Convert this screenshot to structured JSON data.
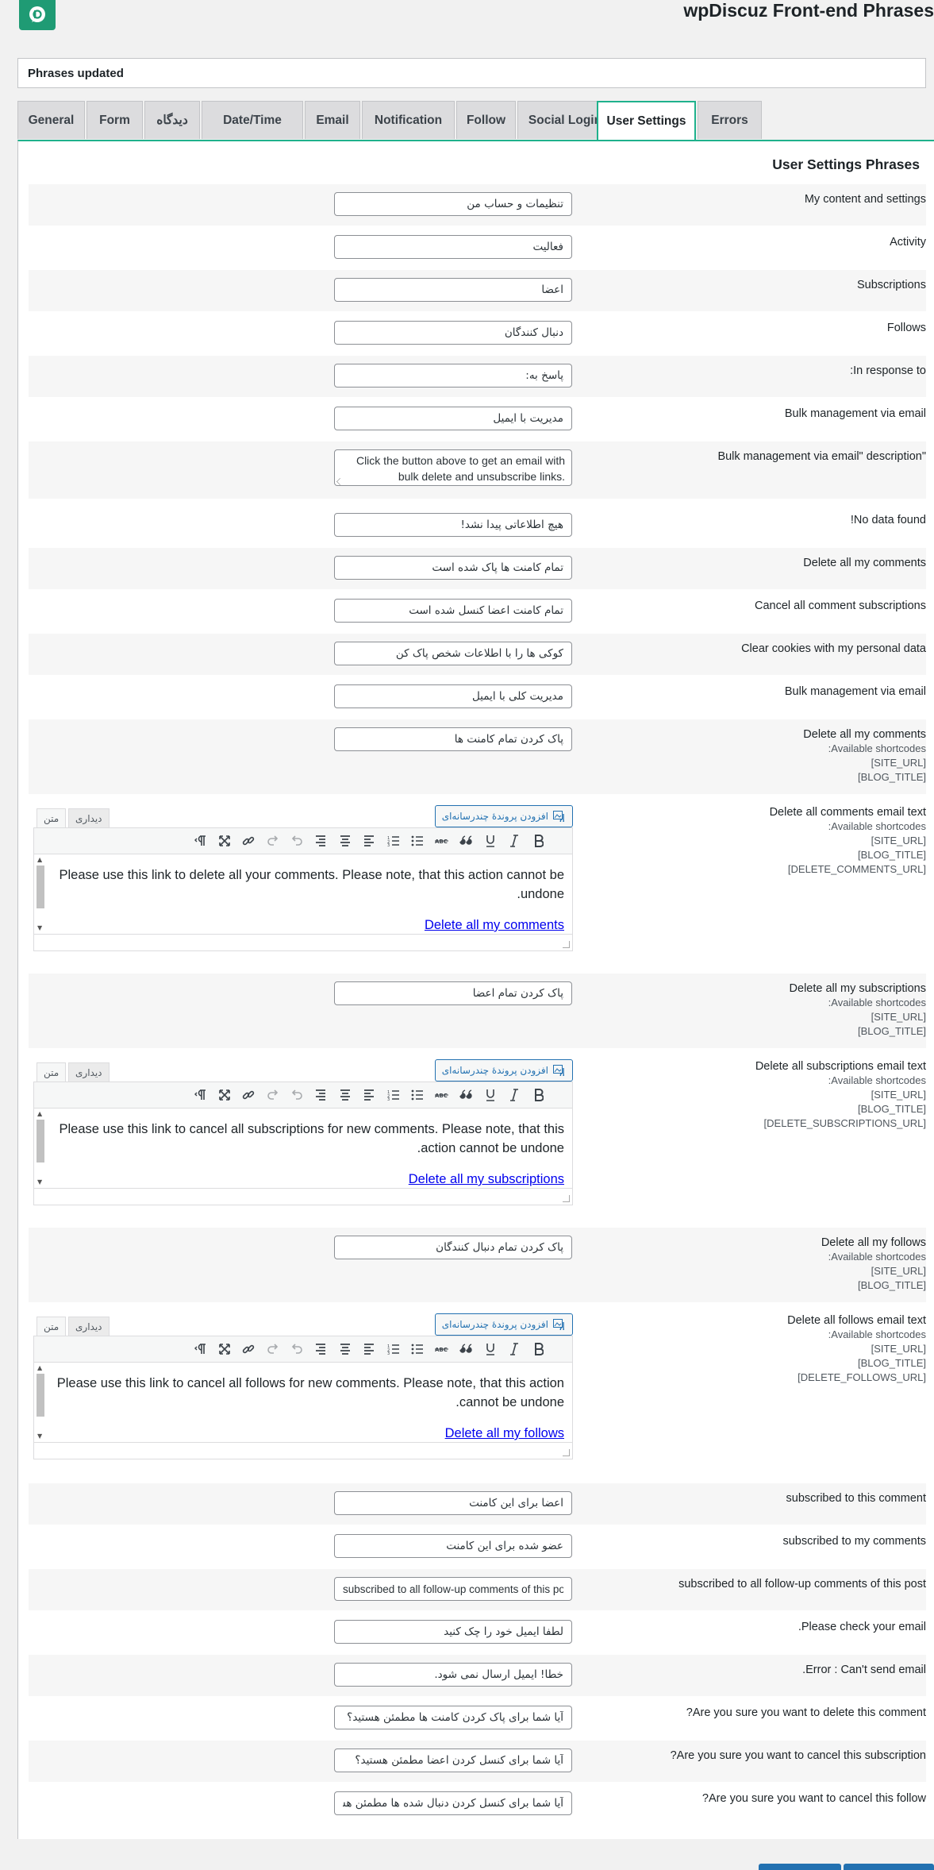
{
  "header": {
    "title": "wpDiscuz Front-end Phrases",
    "logo_icon": "wpdiscuz-logo-icon",
    "notice": "Phrases updated"
  },
  "tabs": [
    {
      "label": "General",
      "active": false
    },
    {
      "label": "Form",
      "active": false
    },
    {
      "label": "دیدگاه",
      "active": false
    },
    {
      "label": "Date/Time",
      "active": false
    },
    {
      "label": "Email",
      "active": false
    },
    {
      "label": "Notification",
      "active": false
    },
    {
      "label": "Follow",
      "active": false
    },
    {
      "label": "Social Login",
      "active": false
    },
    {
      "label": "User Settings",
      "active": true
    },
    {
      "label": "Errors",
      "active": false
    }
  ],
  "section_title": "User Settings Phrases",
  "shortcodes_label": ":Available shortcodes",
  "site_url": "[SITE_URL]",
  "blog_title": "[BLOG_TITLE]",
  "rows": [
    {
      "label": "My content and settings",
      "value": "تنظیمات و حساب من"
    },
    {
      "label": "Activity",
      "value": "فعالیت"
    },
    {
      "label": "Subscriptions",
      "value": "اعضا"
    },
    {
      "label": "Follows",
      "value": "دنبال کنندگان"
    },
    {
      "label": ":In response to",
      "value": "پاسخ به:"
    },
    {
      "label": "Bulk management via email",
      "value": "مدیریت با ایمیل"
    },
    {
      "label": "Bulk management via email\" description\"",
      "value": "Click the button above to get an email with bulk delete and unsubscribe links."
    },
    {
      "label": "!No data found",
      "value": "هیچ اطلاعاتی پیدا نشد!"
    },
    {
      "label": "Delete all my comments",
      "value": "تمام کامنت ها پاک شده است"
    },
    {
      "label": "Cancel all comment subscriptions",
      "value": "تمام کامنت اعضا کنسل شده است"
    },
    {
      "label": "Clear cookies with my personal data",
      "value": "کوکی ها را با اطلاعات شخص پاک کن"
    },
    {
      "label": "Bulk management via email",
      "value": "مدیریت کلی با ایمیل"
    },
    {
      "label": "Delete all my comments",
      "value": "پاک کردن تمام کامنت ها"
    },
    {
      "label": "Delete all comments email text",
      "extra": "[DELETE_COMMENTS_URL]"
    },
    {
      "label": "Delete all my subscriptions",
      "value": "پاک کردن تمام اعضا"
    },
    {
      "label": "Delete all subscriptions email text",
      "extra": "[DELETE_SUBSCRIPTIONS_URL]"
    },
    {
      "label": "Delete all my follows",
      "value": "پاک کردن تمام دنبال کنندگان"
    },
    {
      "label": "Delete all follows email text",
      "extra": "[DELETE_FOLLOWS_URL]"
    },
    {
      "label": "subscribed to this comment",
      "value": "اعضا برای این کامنت"
    },
    {
      "label": "subscribed to my comments",
      "value": "عضو شده برای این کامنت"
    },
    {
      "label": "subscribed to all follow-up comments of this post",
      "value": "subscribed to all follow-up comments of this post"
    },
    {
      "label": ".Please check your email",
      "value": "لطفا ایمیل خود را چک کنید"
    },
    {
      "label": ".Error : Can't send email",
      "value": "خطا! ایمیل ارسال نمی شود."
    },
    {
      "label": "?Are you sure you want to delete this comment",
      "value": "آیا شما برای پاک کردن کامنت ها مطمئن هستید؟"
    },
    {
      "label": "?Are you sure you want to cancel this subscription",
      "value": "آیا شما برای کنسل کردن اعضا مطمئن هستید؟"
    },
    {
      "label": "?Are you sure you want to cancel this follow",
      "value": "آیا شما برای کنسل کردن دنبال شده ها مطمئن هستید؟"
    }
  ],
  "editor": {
    "add_media": "افزودن پروندهٔ چندرسانه‌ای",
    "tab_visual": "دیداری",
    "tab_text": "متن",
    "comments_body": "Please use this link to delete all your comments. Please note, that this action cannot be undone.",
    "comments_link": "Delete all my comments",
    "subscriptions_body": "Please use this link to cancel all subscriptions for new comments. Please note, that this action cannot be undone.",
    "subscriptions_link": "Delete all my subscriptions",
    "follows_body": "Please use this link to cancel all follows for new comments. Please note, that this action cannot be undone.",
    "follows_link": "Delete all my follows"
  },
  "colors": {
    "accent": "#1fb18c",
    "link": "#0000ee",
    "button": "#2271b1"
  }
}
